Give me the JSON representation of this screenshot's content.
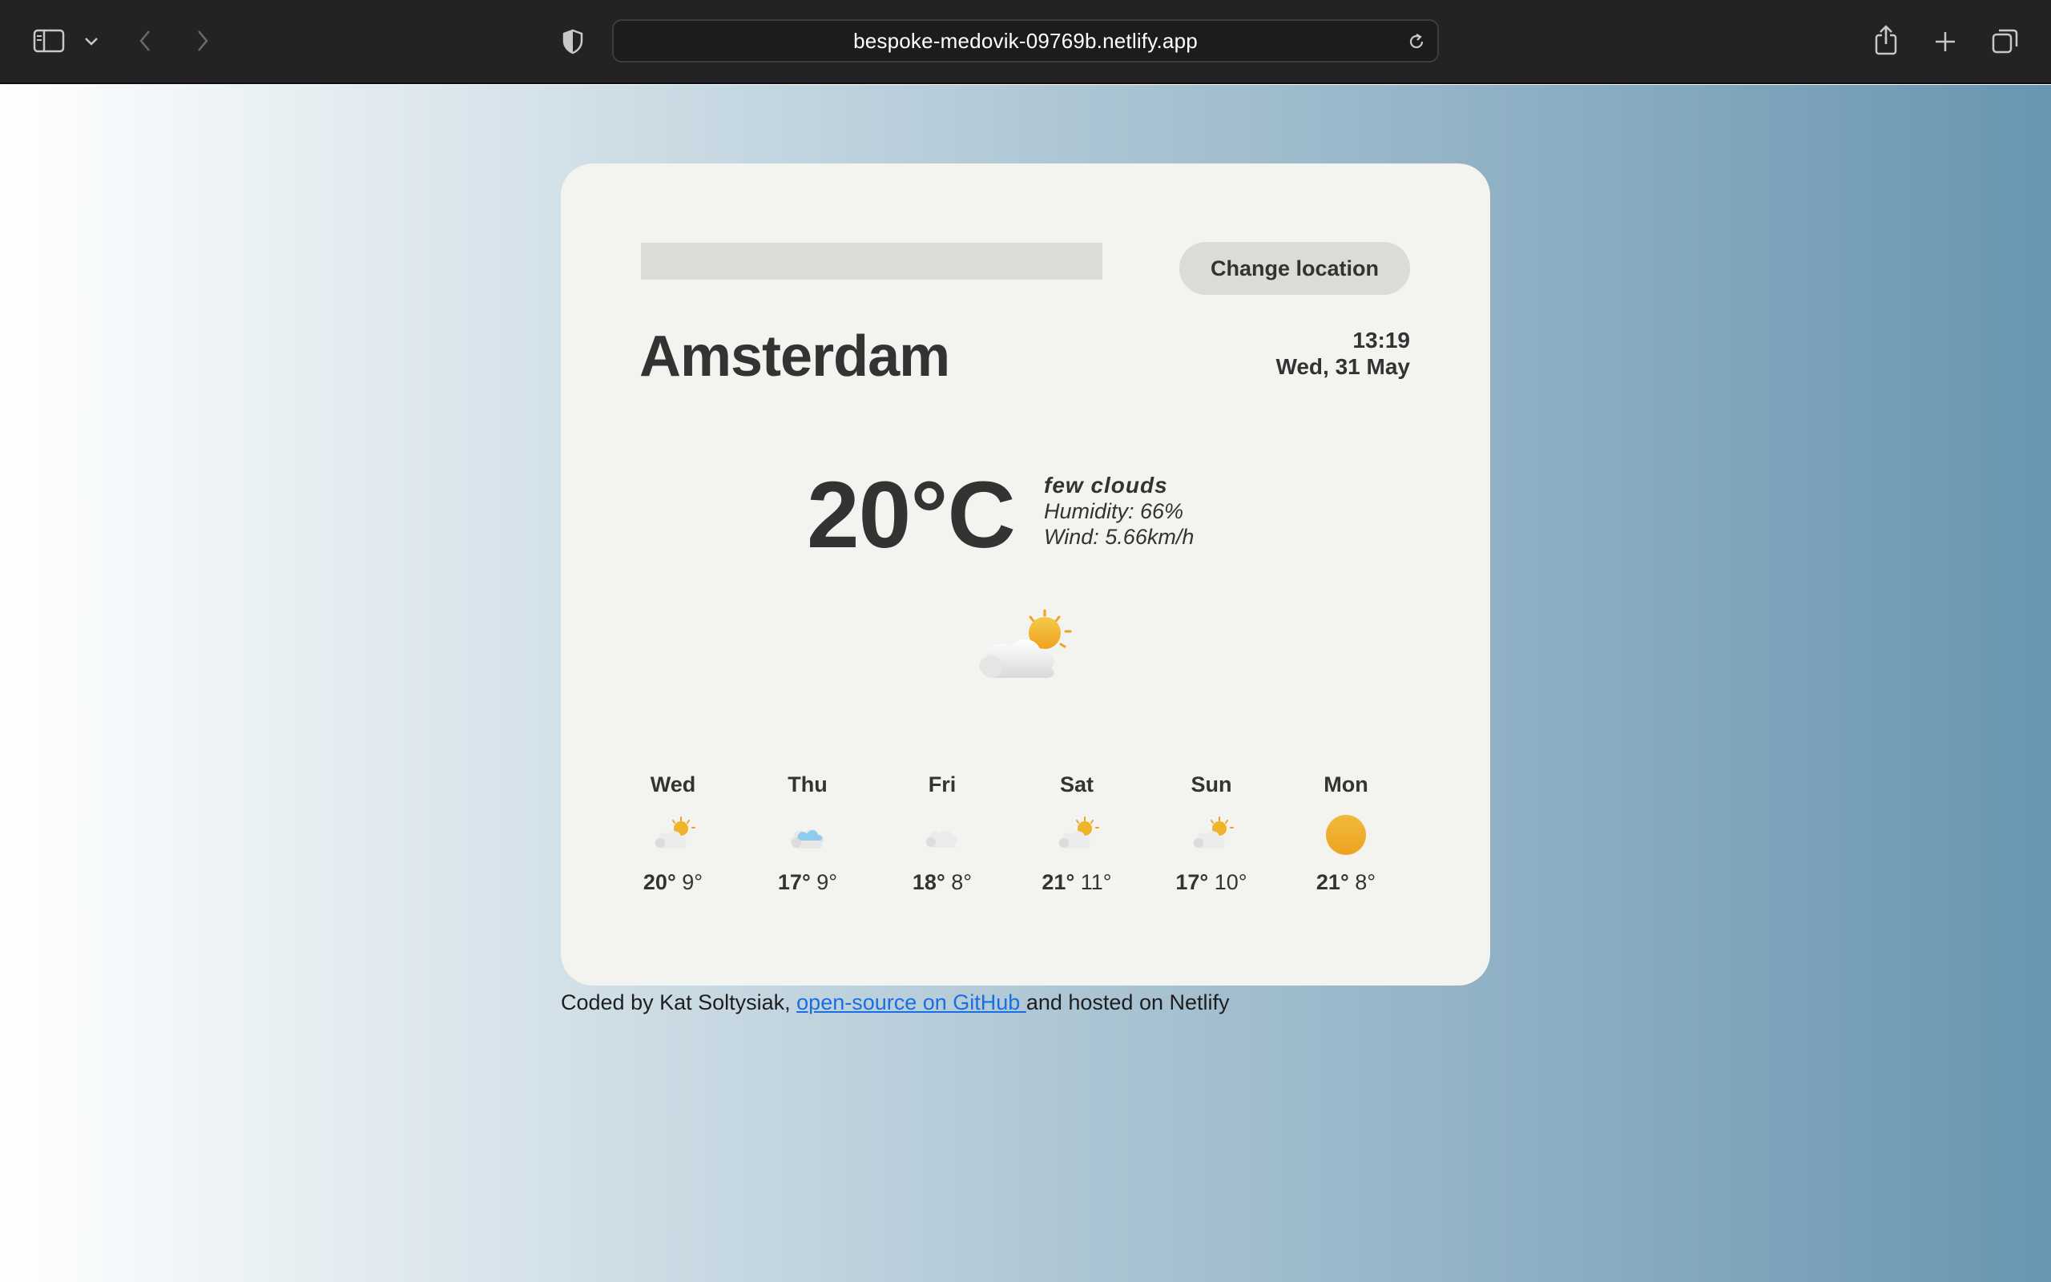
{
  "browser": {
    "url": "bespoke-medovik-09769b.netlify.app"
  },
  "search": {
    "value": "",
    "placeholder": ""
  },
  "change_location_label": "Change location",
  "city": "Amsterdam",
  "time": "13:19",
  "date": "Wed, 31 May",
  "current": {
    "temperature": "20°C",
    "description": "few clouds",
    "humidity": "Humidity: 66%",
    "wind": "Wind: 5.66km/h",
    "icon": "partly-cloudy-icon"
  },
  "forecast": [
    {
      "day": "Wed",
      "max": "20°",
      "min": "9°",
      "icon": "partly-cloudy-icon"
    },
    {
      "day": "Thu",
      "max": "17°",
      "min": "9°",
      "icon": "rain-cloud-icon"
    },
    {
      "day": "Fri",
      "max": "18°",
      "min": "8°",
      "icon": "cloud-icon"
    },
    {
      "day": "Sat",
      "max": "21°",
      "min": "11°",
      "icon": "partly-cloudy-icon"
    },
    {
      "day": "Sun",
      "max": "17°",
      "min": "10°",
      "icon": "partly-cloudy-icon"
    },
    {
      "day": "Mon",
      "max": "21°",
      "min": "8°",
      "icon": "sun-icon"
    }
  ],
  "footer": {
    "prefix": "Coded by Kat Soltysiak, ",
    "link_text": "open-source on GitHub ",
    "suffix": "and hosted on Netlify"
  },
  "colors": {
    "card_background": "#f3f3ef",
    "text": "#333333",
    "link": "#1a6fe0",
    "sun": "#f0b429"
  }
}
